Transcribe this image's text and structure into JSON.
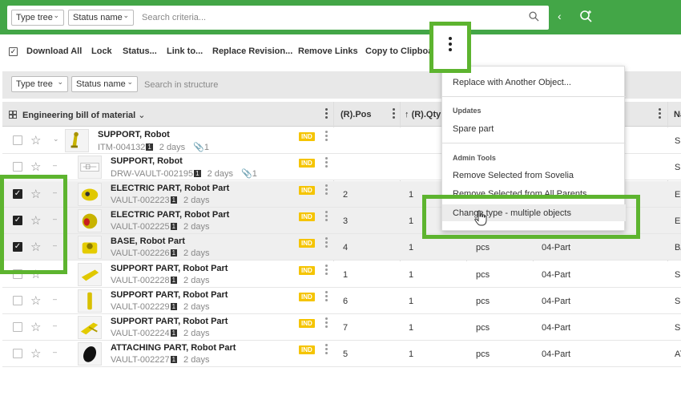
{
  "search": {
    "type_tree": "Type tree",
    "status_name": "Status name",
    "placeholder": "Search criteria..."
  },
  "toolbar": {
    "select_all_checked": true,
    "actions": [
      "Download All",
      "Lock",
      "Status...",
      "Link to...",
      "Replace Revision...",
      "Remove Links",
      "Copy to Clipboard"
    ]
  },
  "filter": {
    "type_tree": "Type tree",
    "status_name": "Status name",
    "placeholder": "Search in structure"
  },
  "table": {
    "columns": {
      "structure": "Engineering bill of material",
      "pos": "(R).Pos",
      "qty": "(R).Qty",
      "last": "Na"
    },
    "rows": [
      {
        "name": "SUPPORT, Robot",
        "id": "ITM-004132",
        "rev": "1",
        "age": "2 days",
        "attachments": "1",
        "badge": "IND",
        "pos": "",
        "qty": "",
        "unit": "",
        "type": "",
        "suffix": "SU",
        "checked": false
      },
      {
        "name": "SUPPORT, Robot",
        "id": "DRW-VAULT-002195",
        "rev": "1",
        "age": "2 days",
        "attachments": "1",
        "badge": "IND",
        "pos": "",
        "qty": "",
        "unit": "",
        "type": "",
        "suffix": "SU",
        "checked": false
      },
      {
        "name": "ELECTRIC PART, Robot Part",
        "id": "VAULT-002223",
        "rev": "1",
        "age": "2 days",
        "attachments": "",
        "badge": "IND",
        "pos": "2",
        "qty": "1",
        "unit": "",
        "type": "",
        "suffix": "EL",
        "checked": true
      },
      {
        "name": "ELECTRIC PART, Robot Part",
        "id": "VAULT-002225",
        "rev": "1",
        "age": "2 days",
        "attachments": "",
        "badge": "IND",
        "pos": "3",
        "qty": "1",
        "unit": "",
        "type": "",
        "suffix": "EL",
        "checked": true
      },
      {
        "name": "BASE, Robot Part",
        "id": "VAULT-002226",
        "rev": "1",
        "age": "2 days",
        "attachments": "",
        "badge": "IND",
        "pos": "4",
        "qty": "1",
        "unit": "pcs",
        "type": "04-Part",
        "suffix": "BA",
        "checked": true
      },
      {
        "name": "SUPPORT PART, Robot Part",
        "id": "VAULT-002228",
        "rev": "1",
        "age": "2 days",
        "attachments": "",
        "badge": "IND",
        "pos": "1",
        "qty": "1",
        "unit": "pcs",
        "type": "04-Part",
        "suffix": "SU",
        "checked": false
      },
      {
        "name": "SUPPORT PART, Robot Part",
        "id": "VAULT-002229",
        "rev": "1",
        "age": "2 days",
        "attachments": "",
        "badge": "IND",
        "pos": "6",
        "qty": "1",
        "unit": "pcs",
        "type": "04-Part",
        "suffix": "SU",
        "checked": false
      },
      {
        "name": "SUPPORT PART, Robot Part",
        "id": "VAULT-002224",
        "rev": "1",
        "age": "2 days",
        "attachments": "",
        "badge": "IND",
        "pos": "7",
        "qty": "1",
        "unit": "pcs",
        "type": "04-Part",
        "suffix": "SU",
        "checked": false
      },
      {
        "name": "ATTACHING PART, Robot Part",
        "id": "VAULT-002227",
        "rev": "1",
        "age": "2 days",
        "attachments": "",
        "badge": "IND",
        "pos": "5",
        "qty": "1",
        "unit": "pcs",
        "type": "04-Part",
        "suffix": "AT",
        "checked": false
      }
    ]
  },
  "menu": {
    "replace": "Replace with Another Object...",
    "updates_header": "Updates",
    "spare_part": "Spare part",
    "admin_header": "Admin Tools",
    "remove_sovelia": "Remove Selected from Sovelia",
    "remove_parents": "Remove Selected from All Parents",
    "change_type": "Change type - multiple objects"
  },
  "colors": {
    "topbar": "#43a647",
    "highlight": "#5db42f",
    "badge": "#f5c400"
  }
}
